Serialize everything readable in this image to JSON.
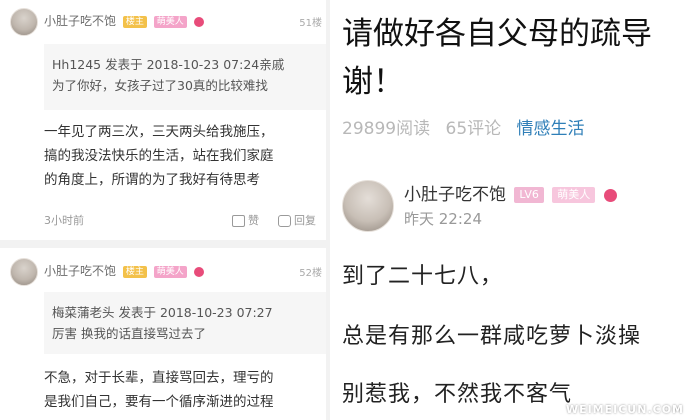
{
  "left": {
    "comments": [
      {
        "username": "小肚子吃不饱",
        "badge1": "楼主",
        "badge2": "萌美人",
        "floor": "51楼",
        "quote": {
          "line1": "Hh1245  发表于  2018-10-23  07:24亲戚",
          "line2": "为了你好，女孩子过了30真的比较难找"
        },
        "text": {
          "line1": "一年见了两三次，三天两头给我施压，",
          "line2": "搞的我没法快乐的生活，站在我们家庭",
          "line3": "的角度上，所谓的为了我好有待思考"
        },
        "time": "3小时前",
        "like": "赞",
        "reply": "回复"
      },
      {
        "username": "小肚子吃不饱",
        "badge1": "楼主",
        "badge2": "萌美人",
        "floor": "52楼",
        "quote": {
          "line1": "梅菜蒲老头  发表于  2018-10-23  07:27",
          "line2": "厉害 换我的话直接骂过去了"
        },
        "text": {
          "line1": "不急，对于长辈，直接骂回去，理亏的",
          "line2": "是我们自己，要有一个循序渐进的过程"
        }
      }
    ]
  },
  "right": {
    "title": {
      "line1": "请做好各自父母的疏导",
      "line2": "谢！"
    },
    "stats": {
      "reads": "29899阅读",
      "comments": "65评论",
      "category": "情感生活"
    },
    "author": {
      "name": "小肚子吃不饱",
      "level": "LV6",
      "badge": "萌美人",
      "time": "昨天  22:24"
    },
    "post_lines": [
      "到了二十七八，",
      "总是有那么一群咸吃萝卜淡操",
      "别惹我，不然我不客气"
    ],
    "watermark": "WEIMEICUN.COM"
  },
  "colors": {
    "category_link": "#2f7fb8",
    "badge_yellow": "#f3c14a",
    "badge_pink": "#f4a4c9",
    "heart": "#e84c7a"
  }
}
